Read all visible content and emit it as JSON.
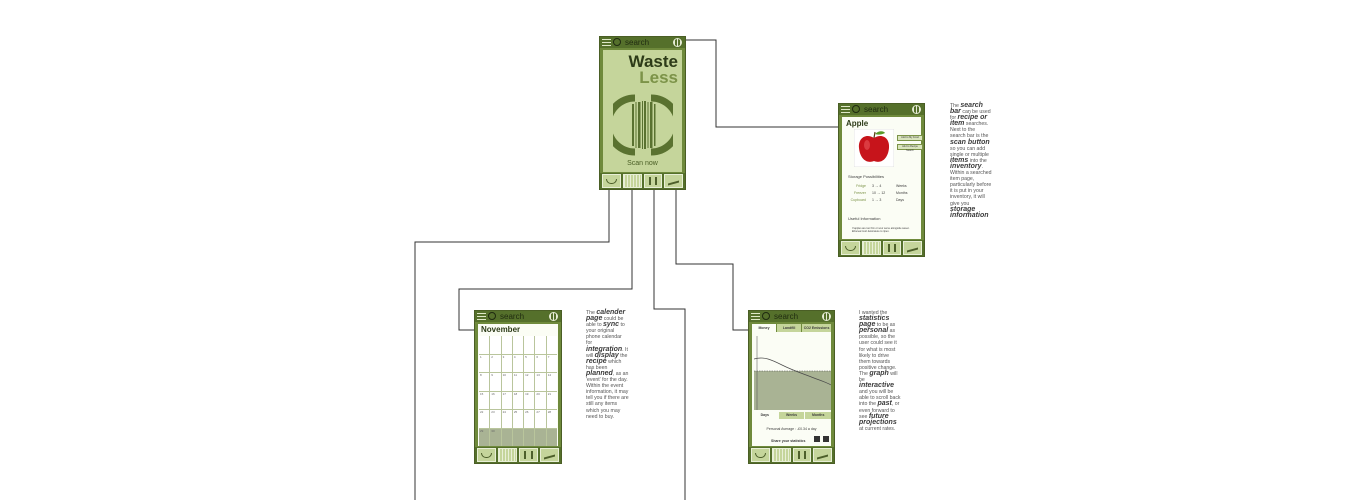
{
  "search_placeholder": "search",
  "home": {
    "title_line1": "Waste",
    "title_line2": "Less",
    "scan_label": "Scan now"
  },
  "item": {
    "title": "Apple",
    "btn_inventory": "Add to My Food",
    "btn_recipe": "Add to Recipe Search",
    "storage_heading": "Storage Possibilities",
    "storage": [
      {
        "place": "Fridge",
        "range": "3 → 4",
        "unit": "Weeks"
      },
      {
        "place": "Freezer",
        "range": "10 → 12",
        "unit": "Months"
      },
      {
        "place": "Cupboard",
        "range": "1 → 3",
        "unit": "Days"
      }
    ],
    "useful_heading": "Useful Information",
    "useful_text": "If apples are too firm or sour serve alongside sweet. Ethereal mort detiorature to ripen."
  },
  "calendar": {
    "month": "November",
    "day_numbers": [
      "",
      "",
      "",
      "",
      "",
      "",
      "",
      "1",
      "2",
      "3",
      "4",
      "5",
      "6",
      "7",
      "8",
      "9",
      "10",
      "11",
      "12",
      "13",
      "14",
      "15",
      "16",
      "17",
      "18",
      "19",
      "20",
      "21",
      "22",
      "23",
      "24",
      "25",
      "26",
      "27",
      "28",
      "29",
      "30",
      "",
      "",
      "",
      "",
      ""
    ]
  },
  "stats": {
    "tabs": [
      "Money",
      "Landfill",
      "CO2 Emissions"
    ],
    "periods": [
      "Days",
      "Weeks",
      "Months"
    ],
    "personal_average": "Personal Average : -£0.34 a day",
    "share_label": "Share your statistics"
  },
  "notes": {
    "search": [
      [
        "The ",
        false
      ],
      [
        "search bar",
        true
      ],
      [
        " can be used for ",
        false
      ],
      [
        "recipe or item",
        true
      ],
      [
        " searches. Next to the search bar is the ",
        false
      ],
      [
        "scan button",
        true
      ],
      [
        " so you can add single or multiple ",
        false
      ],
      [
        "items",
        true
      ],
      [
        " into the ",
        false
      ],
      [
        "inventory",
        true
      ],
      [
        ". Within a searched item page, particularly before it is put in your inventory, it will give you ",
        false
      ],
      [
        "storage information",
        true
      ]
    ],
    "calendar": [
      [
        "The ",
        false
      ],
      [
        "calender page",
        true
      ],
      [
        " could be able to ",
        false
      ],
      [
        "sync",
        true
      ],
      [
        " to your original phone calendar for ",
        false
      ],
      [
        "integration",
        true
      ],
      ". It will ",
      [
        "display",
        true
      ],
      [
        " the ",
        false
      ],
      [
        "recipe",
        true
      ],
      [
        " which has been ",
        false
      ],
      [
        "planned",
        true
      ],
      [
        ", as an 'event' for the day. Within the event information, it may tell you if there are still any items which you may need to buy.",
        false
      ]
    ],
    "stats": [
      [
        "I wanted the ",
        false
      ],
      [
        "statistics page",
        true
      ],
      [
        " to be as ",
        false
      ],
      [
        "personal",
        true
      ],
      [
        " as possible, so the user could see it for what is most likely to drive them towards positive change. The ",
        false
      ],
      [
        "graph",
        true
      ],
      [
        " will be ",
        false
      ],
      [
        "interactive",
        true
      ],
      [
        " and you will be able to scroll back into the ",
        false
      ],
      [
        "past",
        true
      ],
      [
        ", or even forward to see ",
        false
      ],
      [
        "future projections",
        true
      ],
      [
        " at current rates.",
        false
      ]
    ]
  }
}
